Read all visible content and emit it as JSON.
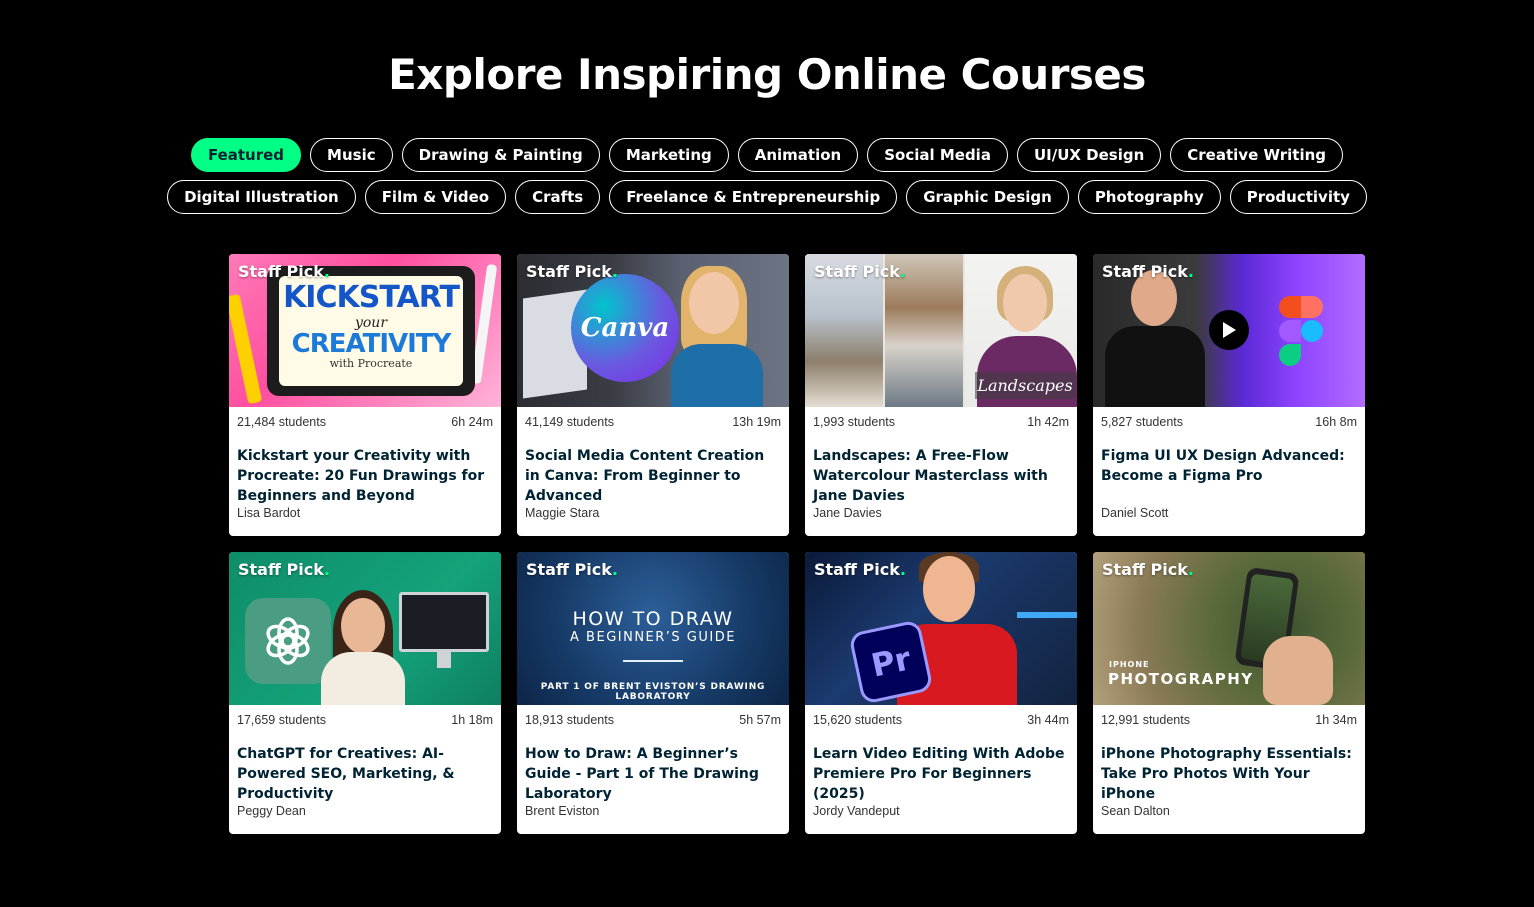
{
  "page": {
    "title": "Explore Inspiring Online Courses"
  },
  "colors": {
    "accent": "#00ff84",
    "card_title": "#002333",
    "background": "#000000"
  },
  "tabs_row1": [
    {
      "label": "Featured",
      "active": true
    },
    {
      "label": "Music"
    },
    {
      "label": "Drawing & Painting"
    },
    {
      "label": "Marketing"
    },
    {
      "label": "Animation"
    },
    {
      "label": "Social Media"
    },
    {
      "label": "UI/UX Design"
    },
    {
      "label": "Creative Writing"
    }
  ],
  "tabs_row2": [
    {
      "label": "Digital Illustration"
    },
    {
      "label": "Film & Video"
    },
    {
      "label": "Crafts"
    },
    {
      "label": "Freelance & Entrepreneurship"
    },
    {
      "label": "Graphic Design"
    },
    {
      "label": "Photography"
    },
    {
      "label": "Productivity"
    }
  ],
  "badge": {
    "text": "Staff Pick",
    "dot": "."
  },
  "courses": [
    {
      "students": "21,484 students",
      "duration": "6h 24m",
      "title": "Kickstart your Creativity with Procreate: 20 Fun Drawings for Beginners and Beyond",
      "teacher": "Lisa Bardot",
      "thumb_text": [
        "KICKSTART",
        "your",
        "CREATIVITY",
        "with Procreate"
      ]
    },
    {
      "students": "41,149 students",
      "duration": "13h 19m",
      "title": "Social Media Content Creation in Canva: From Beginner to Advanced",
      "teacher": "Maggie Stara",
      "thumb_text": [
        "Canva"
      ]
    },
    {
      "students": "1,993 students",
      "duration": "1h 42m",
      "title": "Landscapes: A Free-Flow Watercolour Masterclass with Jane Davies",
      "teacher": "Jane Davies",
      "thumb_text": [
        "Landscapes"
      ]
    },
    {
      "students": "5,827 students",
      "duration": "16h 8m",
      "title": "Figma UI UX Design Advanced: Become a Figma Pro",
      "teacher": "Daniel Scott",
      "thumb_text": []
    },
    {
      "students": "17,659 students",
      "duration": "1h 18m",
      "title": "ChatGPT for Creatives: AI-Powered SEO, Marketing, & Productivity",
      "teacher": "Peggy Dean",
      "thumb_text": []
    },
    {
      "students": "18,913 students",
      "duration": "5h 57m",
      "title": "How to Draw: A Beginner’s Guide - Part 1 of The Drawing Laboratory",
      "teacher": "Brent Eviston",
      "thumb_text": [
        "HOW TO DRAW",
        "A BEGINNER’S GUIDE",
        "PART 1 OF BRENT EVISTON’S DRAWING LABORATORY"
      ]
    },
    {
      "students": "15,620 students",
      "duration": "3h 44m",
      "title": "Learn Video Editing With Adobe Premiere Pro For Beginners (2025)",
      "teacher": "Jordy Vandeput",
      "thumb_text": [
        "Pr"
      ]
    },
    {
      "students": "12,991 students",
      "duration": "1h 34m",
      "title": "iPhone Photography Essentials: Take Pro Photos With Your iPhone",
      "teacher": "Sean Dalton",
      "thumb_text": [
        "IPHONE",
        "PHOTOGRAPHY"
      ]
    }
  ]
}
